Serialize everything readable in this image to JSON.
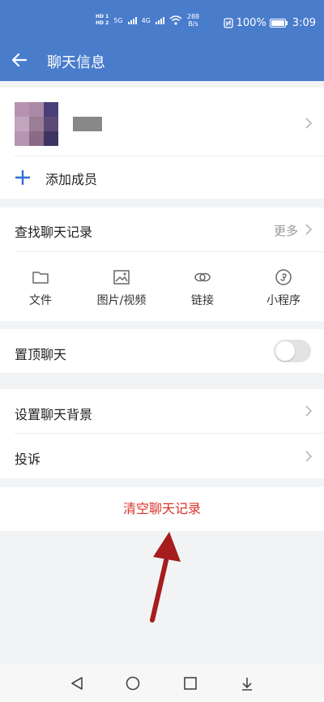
{
  "status_bar": {
    "network_badges": [
      "HD 1",
      "HD 2"
    ],
    "network_types": [
      "5G",
      "4G"
    ],
    "speed_value": "288",
    "speed_unit": "B/s",
    "battery": "100%",
    "battery_level": 1.0,
    "time": "3:09"
  },
  "header": {
    "title": "聊天信息"
  },
  "members": {
    "add_label": "添加成员"
  },
  "search": {
    "title": "查找聊天记录",
    "more_label": "更多",
    "shortcuts": [
      {
        "label": "文件",
        "icon": "folder-icon"
      },
      {
        "label": "图片/视频",
        "icon": "image-icon"
      },
      {
        "label": "链接",
        "icon": "link-icon"
      },
      {
        "label": "小程序",
        "icon": "mini-program-icon"
      }
    ]
  },
  "pin_chat": {
    "label": "置顶聊天",
    "enabled": false
  },
  "settings": {
    "background_label": "设置聊天背景",
    "report_label": "投诉"
  },
  "clear_history_label": "清空聊天记录",
  "colors": {
    "header": "#4a7ccc",
    "accent": "#2f6fd8",
    "danger": "#d9332b",
    "annotation_arrow": "#a51d1d"
  }
}
